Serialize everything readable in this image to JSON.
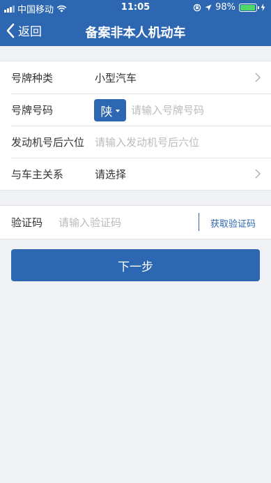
{
  "statusbar": {
    "carrier": "中国移动",
    "time": "11:05",
    "battery": "98%"
  },
  "nav": {
    "back_label": "返回",
    "title": "备案非本人机动车"
  },
  "form": {
    "plate_type": {
      "label": "号牌种类",
      "value": "小型汽车"
    },
    "plate_number": {
      "label": "号牌号码",
      "province": "陕",
      "placeholder": "请输入号牌号码"
    },
    "engine": {
      "label": "发动机号后六位",
      "placeholder": "请输入发动机号后六位"
    },
    "relation": {
      "label": "与车主关系",
      "value": "请选择"
    }
  },
  "verify": {
    "label": "验证码",
    "placeholder": "请输入验证码",
    "get_code": "获取验证码"
  },
  "next_button": "下一步",
  "colors": {
    "primary": "#2d67b1",
    "background": "#f0f1f5",
    "battery": "#4cd964"
  }
}
